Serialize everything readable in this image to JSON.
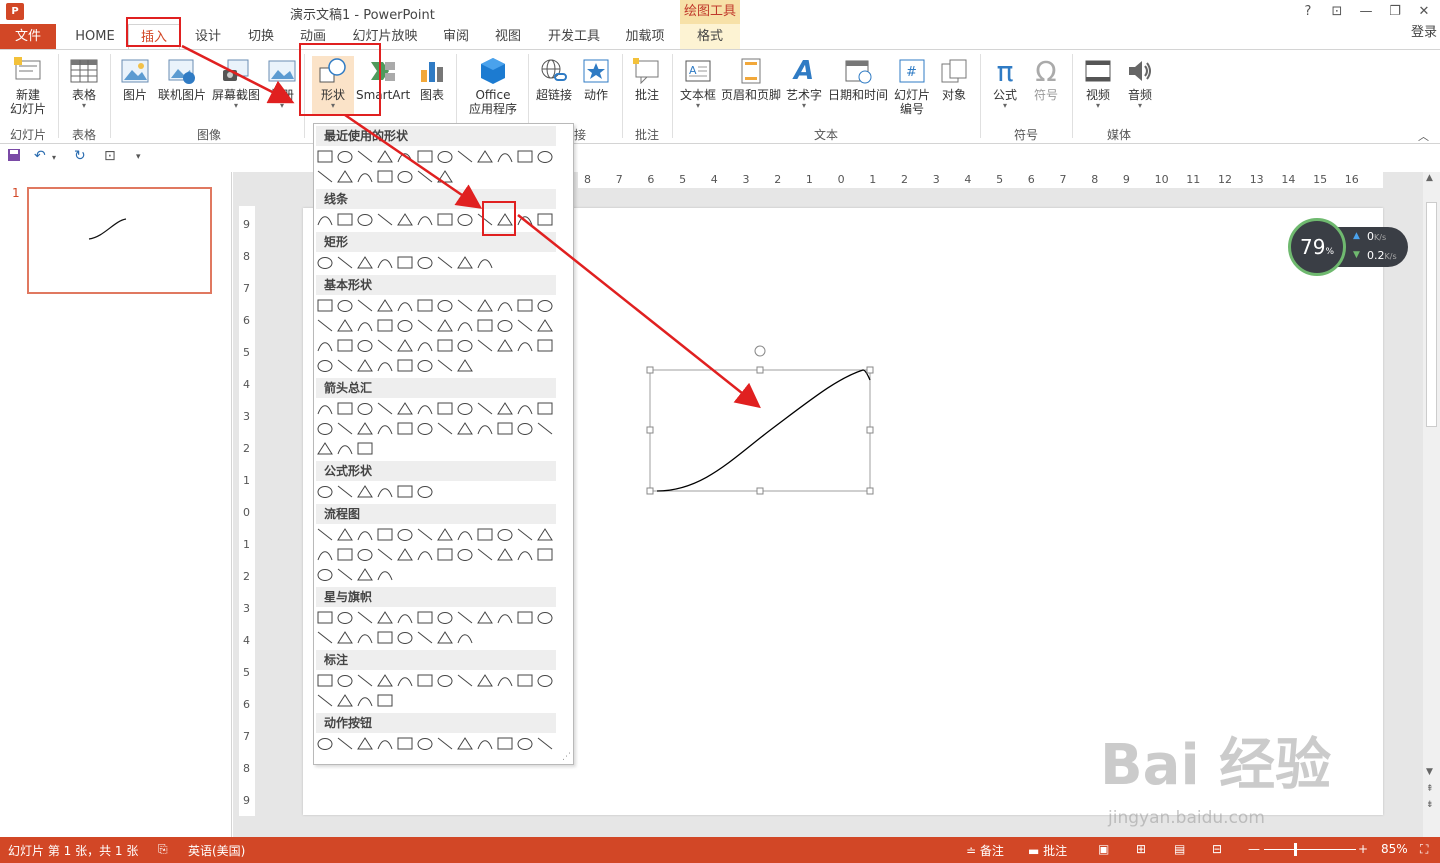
{
  "window": {
    "title": "演示文稿1 - PowerPoint",
    "help": "?",
    "signin": "登录",
    "controls": [
      "⊡",
      "—",
      "❐",
      "✕"
    ]
  },
  "tabs": {
    "file": "文件",
    "home": "HOME",
    "insert": "插入",
    "design": "设计",
    "transitions": "切换",
    "animations": "动画",
    "slideshow": "幻灯片放映",
    "review": "审阅",
    "view": "视图",
    "developer": "开发工具",
    "addins": "加载项",
    "tool_group": "绘图工具",
    "format": "格式"
  },
  "ribbon": {
    "new_slide": "新建",
    "new_slide2": "幻灯片",
    "table": "表格",
    "picture": "图片",
    "online_picture": "联机图片",
    "screenshot": "屏幕截图",
    "album": "相册",
    "shapes": "形状",
    "smartart": "SmartArt",
    "chart": "图表",
    "office_apps": "Office",
    "office_apps2": "应用程序",
    "hyperlink": "超链接",
    "action": "动作",
    "comment": "批注",
    "textbox": "文本框",
    "header_footer": "页眉和页脚",
    "wordart": "艺术字",
    "datetime": "日期和时间",
    "slide_number": "幻灯片",
    "slide_number2": "编号",
    "object": "对象",
    "equation": "公式",
    "symbol": "符号",
    "video": "视频",
    "audio": "音频",
    "groups": {
      "slides": "幻灯片",
      "tables": "表格",
      "images": "图像",
      "links": "接",
      "comments": "批注",
      "text": "文本",
      "symbols": "符号",
      "media": "媒体"
    }
  },
  "shapes_menu": {
    "recent": "最近使用的形状",
    "lines": "线条",
    "rectangles": "矩形",
    "basic": "基本形状",
    "arrows": "箭头总汇",
    "equation": "公式形状",
    "flowchart": "流程图",
    "stars": "星与旗帜",
    "callouts": "标注",
    "action_buttons": "动作按钮"
  },
  "thumbs": {
    "slide_number": "1"
  },
  "ruler": {
    "h_ticks": [
      "8",
      "7",
      "6",
      "5",
      "4",
      "3",
      "2",
      "1",
      "0",
      "1",
      "2",
      "3",
      "4",
      "5",
      "6",
      "7",
      "8",
      "9",
      "10",
      "11",
      "12",
      "13",
      "14",
      "15",
      "16"
    ],
    "v_ticks": [
      "9",
      "8",
      "7",
      "6",
      "5",
      "4",
      "3",
      "2",
      "1",
      "0",
      "1",
      "2",
      "3",
      "4",
      "5",
      "6",
      "7",
      "8",
      "9"
    ]
  },
  "netspeed": {
    "percent": "79",
    "unit": "%",
    "up": "0",
    "down": "0.2",
    "rate_unit": "K/s"
  },
  "status": {
    "slide_info": "幻灯片 第 1 张，共 1 张",
    "language": "英语(美国)",
    "notes": "备注",
    "comments": "批注",
    "zoom": "85%"
  },
  "watermark": {
    "brand": "Bai 经验",
    "url": "jingyan.baidu.com"
  }
}
